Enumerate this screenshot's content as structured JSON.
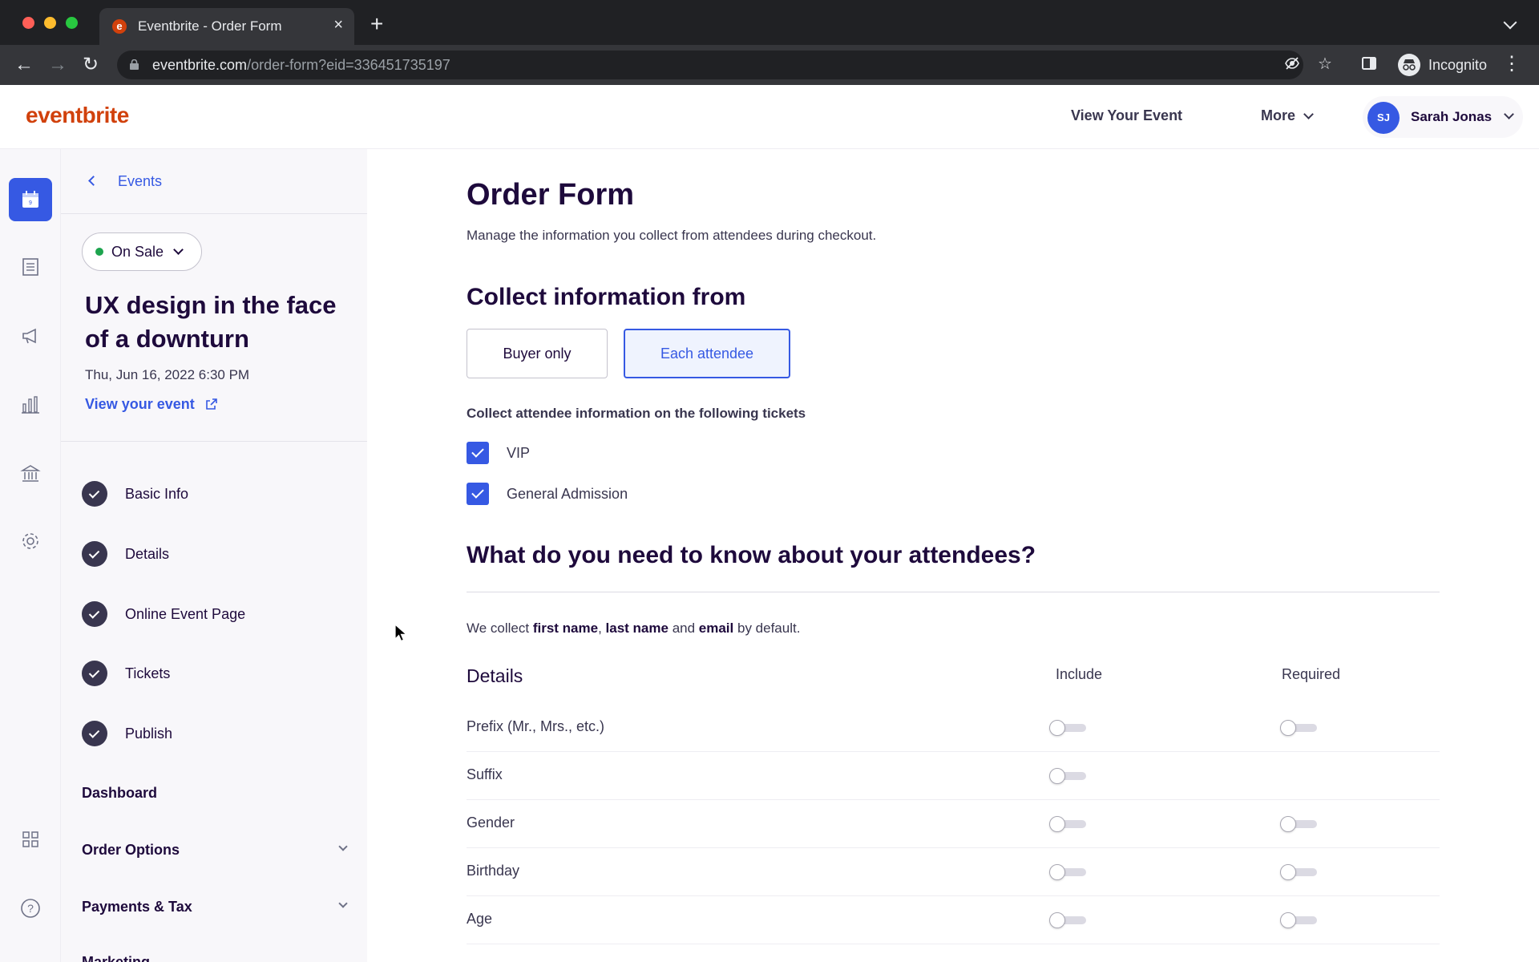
{
  "browser": {
    "tab_title": "Eventbrite - Order Form",
    "url_host": "eventbrite.com",
    "url_path": "/order-form?eid=336451735197",
    "profile_label": "Incognito"
  },
  "header": {
    "logo": "eventbrite",
    "view_event": "View Your Event",
    "more": "More",
    "user_initials": "SJ",
    "user_name": "Sarah Jonas"
  },
  "rail": {
    "items": [
      "calendar-icon",
      "orders-icon",
      "megaphone-icon",
      "bar-chart-icon",
      "bank-icon",
      "gear-icon",
      "apps-grid-icon",
      "help-icon"
    ],
    "active": "calendar-icon"
  },
  "sidebar": {
    "back_label": "Events",
    "status": "On Sale",
    "event_title": "UX design in the face of a downturn",
    "event_date": "Thu, Jun 16, 2022 6:30 PM",
    "view_event": "View your event",
    "steps": [
      "Basic Info",
      "Details",
      "Online Event Page",
      "Tickets",
      "Publish"
    ],
    "sections": [
      "Dashboard",
      "Order Options",
      "Payments & Tax",
      "Marketing"
    ]
  },
  "main": {
    "title": "Order Form",
    "subtitle": "Manage the information you collect from attendees during checkout.",
    "collect_heading": "Collect information from",
    "options": {
      "buyer": "Buyer only",
      "attendee": "Each attendee",
      "selected": "Each attendee"
    },
    "tickets_label": "Collect attendee information on the following tickets",
    "tickets": [
      {
        "name": "VIP",
        "checked": true
      },
      {
        "name": "General Admission",
        "checked": true
      }
    ],
    "know_heading": "What do you need to know about your attendees?",
    "default_note": {
      "pre": "We collect ",
      "first": "first name",
      "sep": ", ",
      "last": "last name",
      "and": " and ",
      "email": "email",
      "post": " by default."
    },
    "table": {
      "section": "Details",
      "col_include": "Include",
      "col_required": "Required",
      "rows": [
        {
          "label": "Prefix (Mr., Mrs., etc.)",
          "include": false,
          "required": false,
          "has_required": true
        },
        {
          "label": "Suffix",
          "include": false,
          "required": false,
          "has_required": false
        },
        {
          "label": "Gender",
          "include": false,
          "required": false,
          "has_required": true
        },
        {
          "label": "Birthday",
          "include": false,
          "required": false,
          "has_required": true
        },
        {
          "label": "Age",
          "include": false,
          "required": false,
          "has_required": true
        }
      ]
    }
  }
}
